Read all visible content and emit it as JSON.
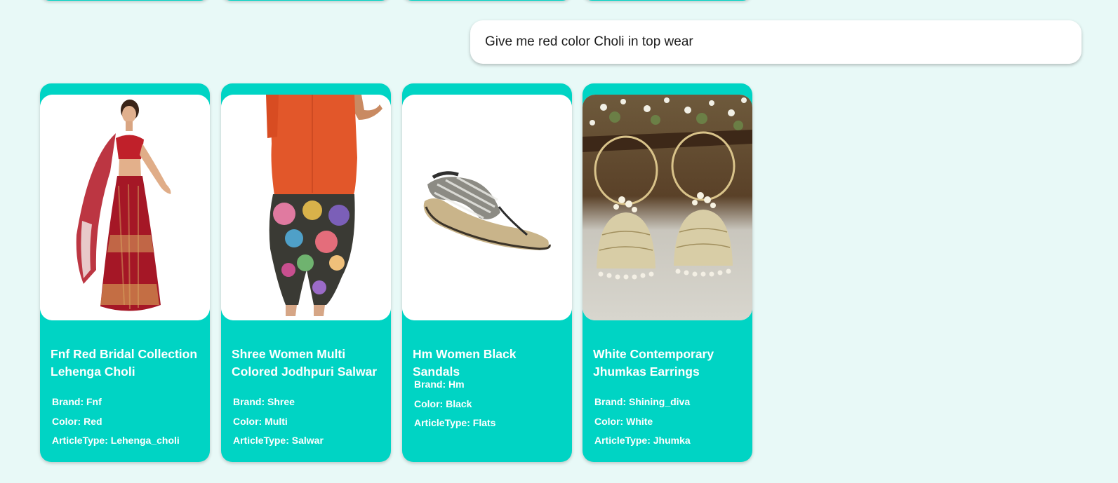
{
  "chat": {
    "user_message": "Give me red color Choli in top wear"
  },
  "labels": {
    "brand": "Brand: ",
    "color": "Color: ",
    "article_type": "ArticleType: "
  },
  "products": [
    {
      "title": "Fnf Red Bridal Collection Lehenga Choli",
      "brand": "Fnf",
      "color": "Red",
      "article_type": "Lehenga_choli",
      "image_icon": "lehenga-choli-image"
    },
    {
      "title": "Shree Women Multi Colored Jodhpuri Salwar",
      "brand": "Shree",
      "color": "Multi",
      "article_type": "Salwar",
      "image_icon": "salwar-image"
    },
    {
      "title": "Hm Women Black Sandals",
      "brand": "Hm",
      "color": "Black",
      "article_type": "Flats",
      "image_icon": "sandal-image"
    },
    {
      "title": "White Contemporary Jhumkas Earrings",
      "brand": "Shining_diva",
      "color": "White",
      "article_type": "Jhumka",
      "image_icon": "jhumka-earrings-image"
    }
  ],
  "colors": {
    "card_accent": "#00d4c4",
    "page_background": "#e8f9f7"
  }
}
